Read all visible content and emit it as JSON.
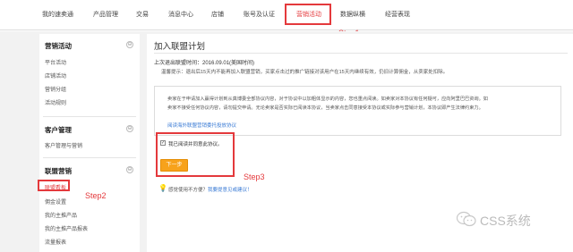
{
  "nav": {
    "items": [
      "我的速卖通",
      "产品管理",
      "交易",
      "消息中心",
      "店铺",
      "账号及认证",
      "营销活动",
      "数据纵横",
      "经营表现"
    ],
    "active_index": 6
  },
  "steps": {
    "step1": "Step1",
    "step2": "Step2",
    "step3": "Step3"
  },
  "sidebar": {
    "sections": [
      {
        "title": "营销活动",
        "items": [
          "平台活动",
          "店铺活动",
          "营销分组",
          "活动规则"
        ]
      },
      {
        "title": "客户管理",
        "items": [
          "客户管理与营销"
        ]
      },
      {
        "title": "联盟营销",
        "items": [
          "联盟看板",
          "佣金设置",
          "我的主推产品",
          "我的主推产品报表",
          "流量报表"
        ]
      }
    ],
    "toggle_symbol": "⊖"
  },
  "main": {
    "title": "加入联盟计划",
    "last_exit": "上次退出联盟时间：2016.09.01(美国时间)",
    "tip": "温馨提示：退出后15天内不能再加入联盟营销，买家点击过的推广链接对该用户在15天内继续有效，仍旧计算佣金，从卖家处扣除。",
    "notice_lines": [
      "卖家在于申请加入赢得计划到从真博委全部协议内容，对于协议中以加粗体显示的内容，您也重点阅读。如卖家对本协议有任何疑可，应向阿里巴巴资询。如",
      "卖家不接受任何协议内容，请勿提交申请。无论卖家是否实际已阅读本协议，当卖家点击同意接受本协议或实际参与营销计划，本协议即产生法律约束力。"
    ],
    "notice_link": "阅读海外联盟营销委托投放协议",
    "agree_label": "我已阅读并同意此协议。",
    "checkbox_mark": "✓",
    "next_button": "下一步",
    "hint_text": "感觉使用不方便？",
    "hint_link": "我要提意见或建议！",
    "hint_icon": "💡"
  },
  "watermark": {
    "text": "CSS系统"
  },
  "colors": {
    "accent_red": "#e4393c",
    "button_orange": "#f7a21b",
    "link_blue": "#3a7bd5"
  }
}
